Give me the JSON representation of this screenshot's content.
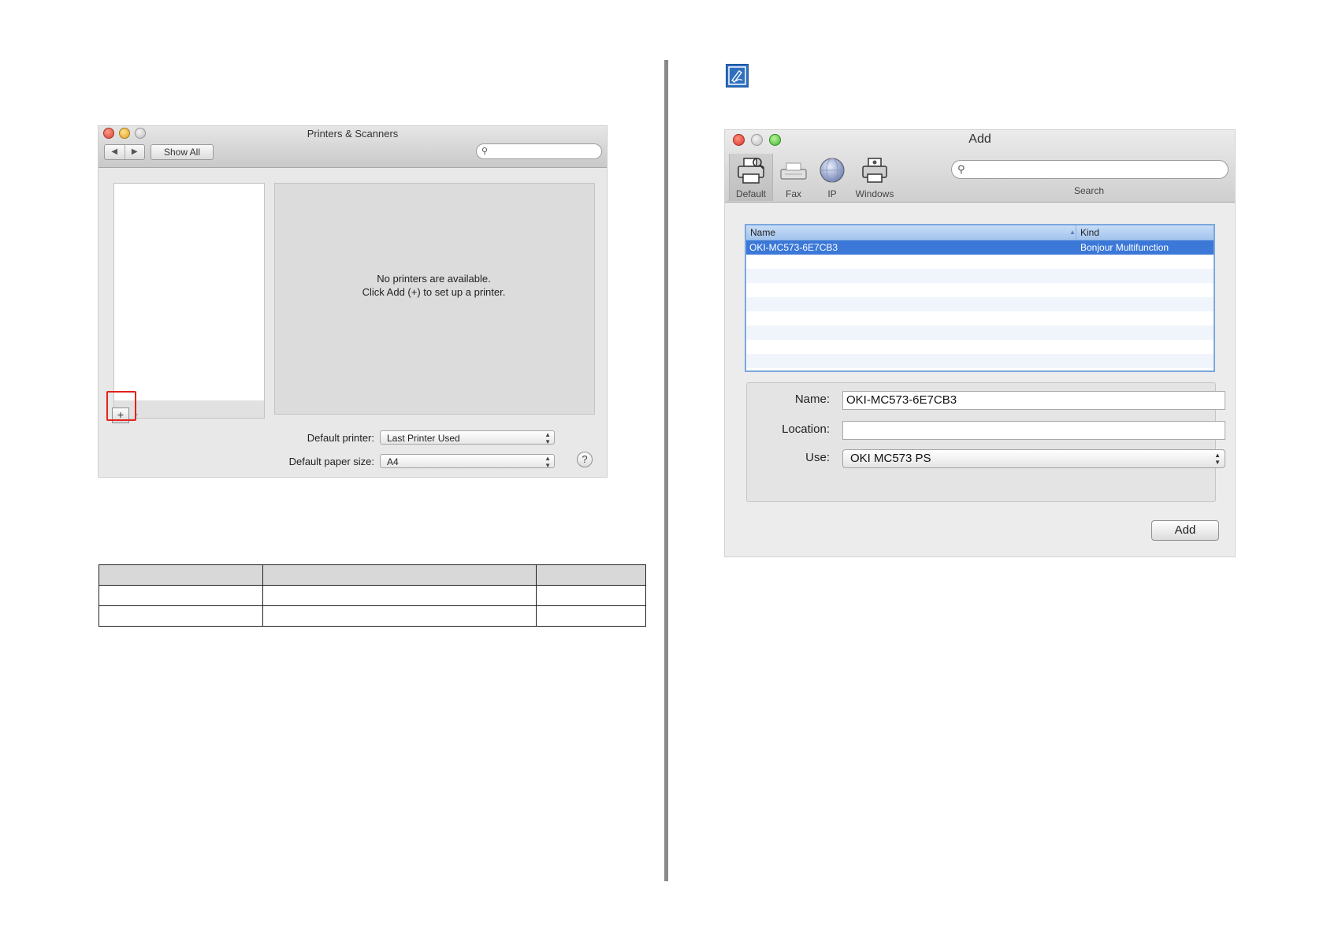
{
  "printers_window": {
    "title": "Printers & Scanners",
    "nav_back": "◀",
    "nav_forward": "▶",
    "show_all": "Show All",
    "search_placeholder": "",
    "empty_line1": "No printers are available.",
    "empty_line2": "Click Add (+) to set up a printer.",
    "add_symbol": "+",
    "remove_symbol": "-",
    "default_printer_label": "Default printer:",
    "default_printer_value": "Last Printer Used",
    "default_paper_label": "Default paper size:",
    "default_paper_value": "A4",
    "help_symbol": "?"
  },
  "add_window": {
    "title": "Add",
    "toolbar": [
      {
        "label": "Default",
        "icon": "printer-icon"
      },
      {
        "label": "Fax",
        "icon": "fax-icon"
      },
      {
        "label": "IP",
        "icon": "globe-icon"
      },
      {
        "label": "Windows",
        "icon": "windows-printer-icon"
      }
    ],
    "search_label": "Search",
    "table": {
      "col_name": "Name",
      "col_kind": "Kind",
      "rows": [
        {
          "name": "OKI-MC573-6E7CB3",
          "kind": "Bonjour Multifunction"
        }
      ]
    },
    "name_label": "Name:",
    "name_value": "OKI-MC573-6E7CB3",
    "location_label": "Location:",
    "location_value": "",
    "use_label": "Use:",
    "use_value": "OKI MC573 PS",
    "add_button": "Add"
  },
  "colors": {
    "selection": "#3b78d8",
    "highlight_frame": "#e2231a",
    "note_icon": "#2e6fc0"
  }
}
